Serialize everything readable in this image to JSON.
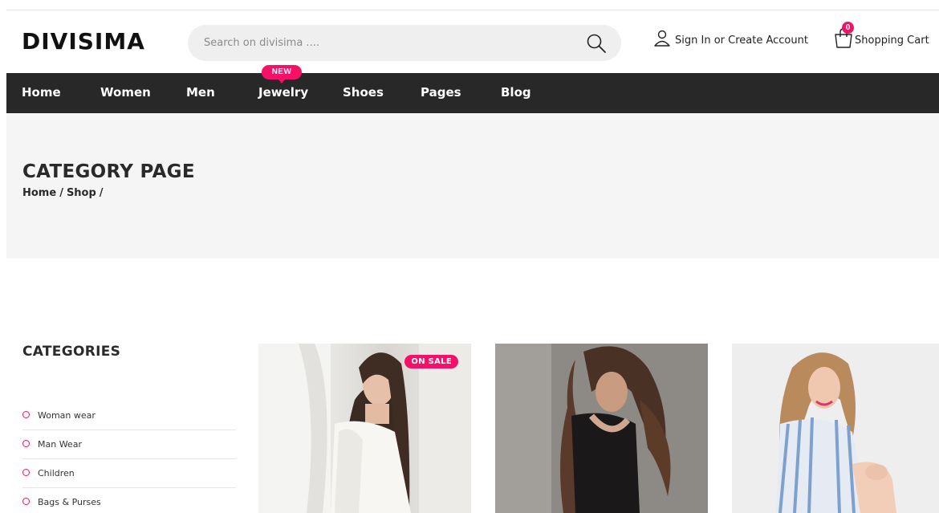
{
  "header": {
    "logo": "DIVISIMA",
    "search": {
      "placeholder": "Search on divisima ....",
      "icon": "search-icon"
    },
    "account": {
      "label": "Sign In or Create Account",
      "icon": "user-icon"
    },
    "cart": {
      "label": "Shopping Cart",
      "count": "0",
      "icon": "shopping-bag-icon"
    }
  },
  "nav": {
    "items": [
      {
        "label": "Home"
      },
      {
        "label": "Women"
      },
      {
        "label": "Men"
      },
      {
        "label": "Jewelry",
        "badge": "NEW"
      },
      {
        "label": "Shoes"
      },
      {
        "label": "Pages"
      },
      {
        "label": "Blog"
      }
    ]
  },
  "banner": {
    "title": "CATEGORY PAGE",
    "breadcrumb": [
      "Home",
      "/",
      "Shop",
      "/"
    ]
  },
  "sidebar": {
    "title": "CATEGORIES",
    "items": [
      {
        "label": "Woman wear"
      },
      {
        "label": "Man Wear"
      },
      {
        "label": "Children"
      },
      {
        "label": "Bags & Purses"
      }
    ]
  },
  "products": [
    {
      "tag": "ON SALE"
    },
    {},
    {}
  ],
  "colors": {
    "accent": "#f51167",
    "nav_bg": "#282828",
    "banner_bg": "#f6f5f5"
  }
}
